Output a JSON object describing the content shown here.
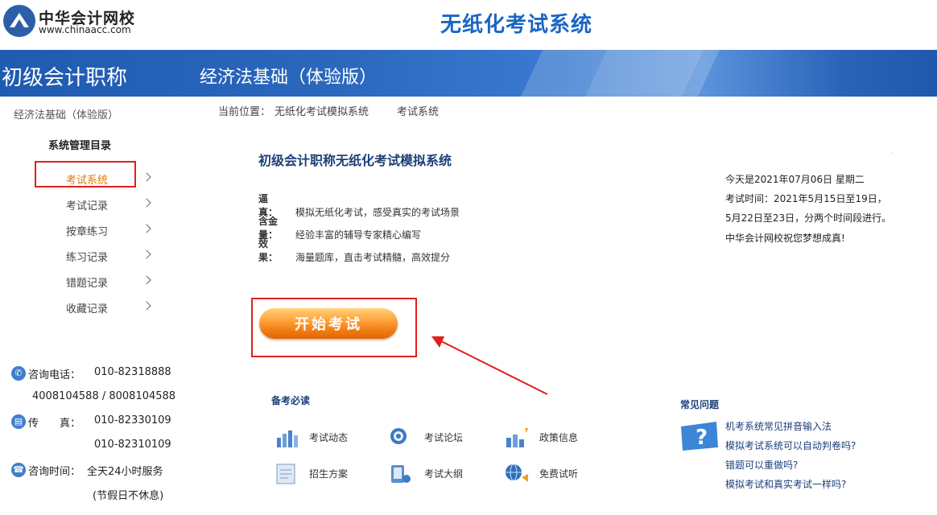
{
  "header": {
    "logo_name": "中华会计网校",
    "logo_url": "www.chinaacc.com",
    "system_title": "无纸化考试系统"
  },
  "banner": {
    "category": "初级会计职称",
    "subject": "经济法基础（体验版）"
  },
  "sidebar": {
    "subject": "经济法基础（体验版）",
    "menu_title": "系统管理目录",
    "items": [
      {
        "label": "考试系统",
        "active": true
      },
      {
        "label": "考试记录"
      },
      {
        "label": "按章练习"
      },
      {
        "label": "练习记录"
      },
      {
        "label": "错题记录"
      },
      {
        "label": "收藏记录"
      }
    ],
    "contact": {
      "phone_label": "咨询电话：",
      "phone_1": "010-82318888",
      "phone_2": "4008104588 / 8008104588",
      "fax_label": "传　　真：",
      "fax_1": "010-82330109",
      "fax_2": "010-82310109",
      "hours_label": "咨询时间：",
      "hours_1": "全天24小时服务",
      "hours_2": "(节假日不休息)"
    }
  },
  "breadcrumb": {
    "label": "当前位置：",
    "items": [
      "无纸化考试模拟系统",
      "考试系统"
    ]
  },
  "main": {
    "title": "初级会计职称无纸化考试模拟系统",
    "features": [
      {
        "key": "逼　真：",
        "text": "模拟无纸化考试，感受真实的考试场景"
      },
      {
        "key": "含金量：",
        "text": "经验丰富的辅导专家精心编写"
      },
      {
        "key": "效　果：",
        "text": "海量题库，直击考试精髓，高效提分"
      }
    ],
    "start_button": "开始考试"
  },
  "info": {
    "today": "今天是2021年07月06日 星期二",
    "exam_time_1": "考试时间：2021年5月15日至19日，",
    "exam_time_2": "5月22日至23日，分两个时间段进行。",
    "wish": "中华会计网校祝您梦想成真!"
  },
  "prep": {
    "title": "备考必读",
    "links": [
      {
        "label": "考试动态",
        "icon": "chart-icon"
      },
      {
        "label": "考试论坛",
        "icon": "globe-icon"
      },
      {
        "label": "政策信息",
        "icon": "chart-icon"
      },
      {
        "label": "招生方案",
        "icon": "document-icon"
      },
      {
        "label": "考试大纲",
        "icon": "monitor-icon"
      },
      {
        "label": "免费试听",
        "icon": "globe-icon"
      }
    ]
  },
  "faq": {
    "title": "常见问题",
    "items": [
      "机考系统常见拼音输入法",
      "模拟考试系统可以自动判卷吗?",
      "错题可以重做吗?",
      "模拟考试和真实考试一样吗?"
    ]
  },
  "colors": {
    "brand_blue": "#1a66c4",
    "highlight_red": "#e0201d",
    "active_orange": "#e07a10"
  }
}
